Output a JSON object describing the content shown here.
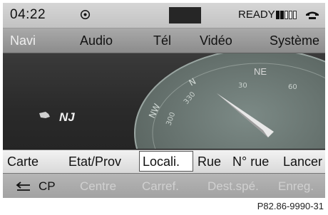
{
  "status": {
    "time": "04:22",
    "ready_label": "READY",
    "signal_bars_filled": 2,
    "signal_bars_total": 5
  },
  "main_menu": {
    "items": [
      "Navi",
      "Audio",
      "Tél",
      "Vidéo",
      "Système"
    ],
    "active": "Navi"
  },
  "map": {
    "state_label": "NJ",
    "compass_heading_label": "NE",
    "compass_ticks": [
      "30",
      "60",
      "330",
      "300",
      "N",
      "NW"
    ]
  },
  "sub_menu": {
    "items": [
      "Carte",
      "Etat/Prov",
      "Locali.",
      "Rue",
      "N° rue",
      "Lancer"
    ],
    "selected": "Locali."
  },
  "bottom_bar": {
    "items": [
      "CP",
      "Centre",
      "Carref.",
      "Dest.spé.",
      "Enreg."
    ],
    "enabled": [
      "CP"
    ]
  },
  "caption": "P82.86-9990-31",
  "colors": {
    "active_menu_text": "#eeeeee",
    "dimmed_text": "#d0d0d0",
    "map_background": "#2e2e2e"
  }
}
